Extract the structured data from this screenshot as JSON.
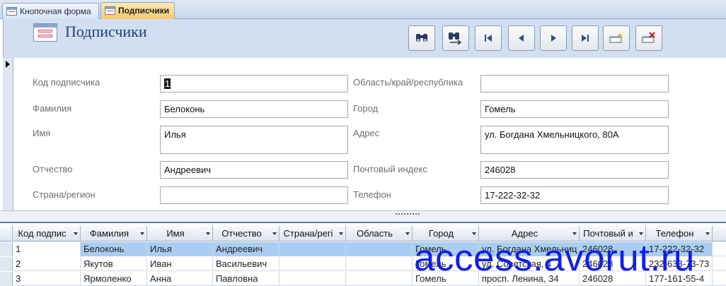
{
  "tabs": [
    {
      "label": "Кнопочная форма",
      "active": false
    },
    {
      "label": "Подписчики",
      "active": true
    }
  ],
  "header": {
    "title": "Подписчики",
    "buttons": [
      {
        "name": "find-icon"
      },
      {
        "name": "find-next-icon"
      },
      {
        "name": "first-record-icon"
      },
      {
        "name": "previous-record-icon"
      },
      {
        "name": "next-record-icon"
      },
      {
        "name": "last-record-icon"
      },
      {
        "name": "new-record-icon"
      },
      {
        "name": "delete-record-icon"
      }
    ]
  },
  "form": {
    "left": [
      {
        "label": "Код подписчика",
        "value": "1"
      },
      {
        "label": "Фамилия",
        "value": "Белоконь"
      },
      {
        "label": "Имя",
        "value": "Илья"
      },
      {
        "label": "Отчество",
        "value": "Андреевич"
      },
      {
        "label": "Страна/регион",
        "value": ""
      }
    ],
    "right": [
      {
        "label": "Область/край/республика",
        "value": ""
      },
      {
        "label": "Город",
        "value": "Гомель"
      },
      {
        "label": "Адрес",
        "value": "ул. Богдана Хмельницкого, 80А"
      },
      {
        "label": "Почтовый индекс",
        "value": "246028"
      },
      {
        "label": "Телефон",
        "value": "17-222-32-32"
      }
    ]
  },
  "datasheet": {
    "columns": [
      "Код подпис",
      "Фамилия",
      "Имя",
      "Отчество",
      "Страна/регі",
      "Область",
      "Город",
      "Адрес",
      "Почтовый и",
      "Телефон"
    ],
    "rows": [
      [
        "1",
        "Белоконь",
        "Илья",
        "Андреевич",
        "",
        "",
        "Гомель",
        "ул. Богдана Хмельниц",
        "246028",
        "17-222-32-32"
      ],
      [
        "2",
        "Якутов",
        "Иван",
        "Васильевич",
        "",
        "",
        "Гомель",
        "ул. Советская, 4",
        "246028",
        "232-633-73-73"
      ],
      [
        "3",
        "Ярмоленко",
        "Анна",
        "Павловна",
        "",
        "",
        "Гомель",
        "просп. Ленина, 34",
        "246028",
        "177-161-55-4"
      ]
    ]
  },
  "watermark": "access.avorut.ru",
  "colors": {
    "active_tab": "#f8c969",
    "header_band": "#d2dff0",
    "selected_row": "#a9cdf3",
    "watermark": "#1020e8"
  }
}
